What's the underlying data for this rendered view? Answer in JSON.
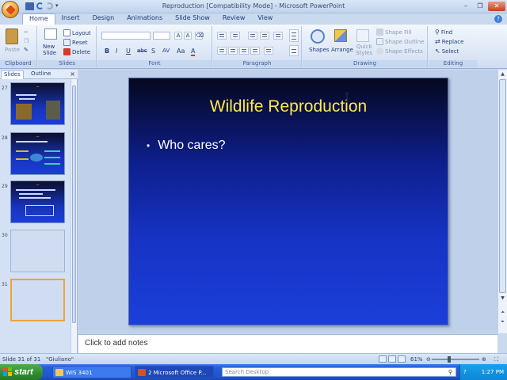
{
  "window": {
    "title": "Reproduction [Compatibility Mode] - Microsoft PowerPoint"
  },
  "ribbon": {
    "tabs": [
      "Home",
      "Insert",
      "Design",
      "Animations",
      "Slide Show",
      "Review",
      "View"
    ],
    "clipboard": {
      "label": "Clipboard",
      "paste": "Paste"
    },
    "slides": {
      "label": "Slides",
      "new_slide": "New Slide",
      "layout": "Layout",
      "reset": "Reset",
      "delete": "Delete"
    },
    "font": {
      "label": "Font"
    },
    "paragraph": {
      "label": "Paragraph"
    },
    "drawing": {
      "label": "Drawing",
      "shapes": "Shapes",
      "arrange": "Arrange",
      "quick_styles": "Quick Styles",
      "shape_fill": "Shape Fill",
      "shape_outline": "Shape Outline",
      "shape_effects": "Shape Effects"
    },
    "editing": {
      "label": "Editing",
      "find": "Find",
      "replace": "Replace",
      "select": "Select"
    }
  },
  "panel": {
    "tabs": [
      "Slides",
      "Outline"
    ],
    "slides": [
      {
        "num": "27",
        "kind": "dark"
      },
      {
        "num": "28",
        "kind": "dark"
      },
      {
        "num": "29",
        "kind": "dark"
      },
      {
        "num": "30",
        "kind": "blank"
      },
      {
        "num": "31",
        "kind": "selected"
      }
    ]
  },
  "slide": {
    "title": "Wildlife Reproduction",
    "bullets": [
      "Who cares?"
    ]
  },
  "notes": {
    "placeholder": "Click to add notes"
  },
  "status": {
    "slide_count": "Slide 31 of 31",
    "theme": "\"Giuliano\"",
    "zoom": "61%"
  },
  "taskbar": {
    "start": "start",
    "items": [
      "WIS 3401",
      "2 Microsoft Office P..."
    ],
    "search_placeholder": "Search Desktop",
    "clock": "1:27 PM"
  }
}
